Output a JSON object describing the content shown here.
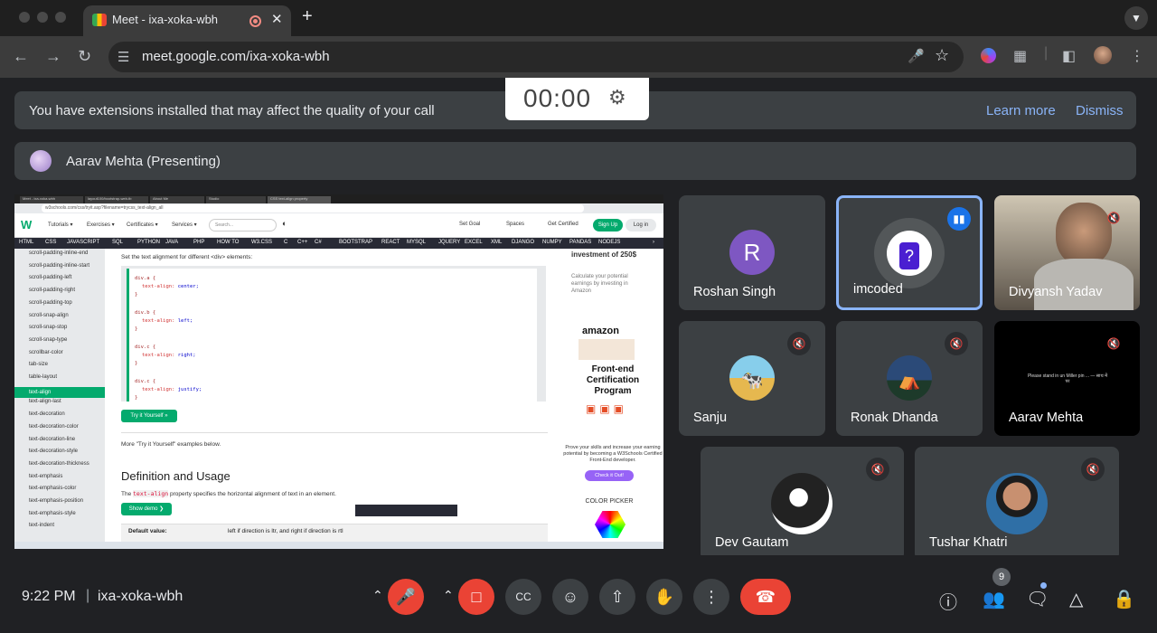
{
  "browser": {
    "tab_title": "Meet - ixa-xoka-wbh",
    "url": "meet.google.com/ixa-xoka-wbh",
    "new_tab": "+",
    "close": "✕"
  },
  "banner": {
    "message": "You have extensions installed that may affect the quality of your call",
    "learn_more": "Learn more",
    "dismiss": "Dismiss"
  },
  "timer": {
    "time": "00:00"
  },
  "presenter": {
    "label": "Aarav Mehta (Presenting)"
  },
  "shared_screen": {
    "mini_tabs": [
      "Meet - ixa-xoka-wbh",
      "layout100/bootstrap-web-tb",
      "About Me",
      "Studio",
      "CSS text-align property"
    ],
    "mini_url": "w3schools.com/css/tryit.asp?filename=trycss_text-align_all",
    "logo": "W",
    "nav": [
      "Tutorials ▾",
      "Exercises ▾",
      "Certificates ▾",
      "Services ▾"
    ],
    "search_placeholder": "Search...",
    "nav_right": [
      "Set Goal",
      "Spaces",
      "Get Certified"
    ],
    "sign_up": "Sign Up",
    "log_in": "Log in",
    "menu": [
      "HTML",
      "CSS",
      "JAVASCRIPT",
      "SQL",
      "PYTHON",
      "JAVA",
      "PHP",
      "HOW TO",
      "W3.CSS",
      "C",
      "C++",
      "C#",
      "BOOTSTRAP",
      "REACT",
      "MYSQL",
      "JQUERY",
      "EXCEL",
      "XML",
      "DJANGO",
      "NUMPY",
      "PANDAS",
      "NODEJS"
    ],
    "sidebar": [
      "scroll-padding-inline-end",
      "scroll-padding-inline-start",
      "scroll-padding-left",
      "scroll-padding-right",
      "scroll-padding-top",
      "scroll-snap-align",
      "scroll-snap-stop",
      "scroll-snap-type",
      "scrollbar-color",
      "tab-size",
      "table-layout",
      "text-align",
      "text-align-last",
      "text-decoration",
      "text-decoration-color",
      "text-decoration-line",
      "text-decoration-style",
      "text-decoration-thickness",
      "text-emphasis",
      "text-emphasis-color",
      "text-emphasis-position",
      "text-emphasis-style",
      "text-indent"
    ],
    "sidebar_active": "text-align",
    "intro": "Set the text alignment for different <div> elements:",
    "code": [
      {
        "sel": "div.a {",
        "prop": "text-align:",
        "val": "center;"
      },
      {
        "sel": "div.b {",
        "prop": "text-align:",
        "val": "left;"
      },
      {
        "sel": "div.c {",
        "prop": "text-align:",
        "val": "right;"
      },
      {
        "sel": "div.c {",
        "prop": "text-align:",
        "val": "justify;"
      }
    ],
    "close_brace": "}",
    "try_btn": "Try it Yourself »",
    "more": "More \"Try it Yourself\" examples below.",
    "def_heading": "Definition and Usage",
    "def_text_pre": "The",
    "def_code": "text-align",
    "def_text_post": "property specifies the horizontal alignment of text in an element.",
    "show_demo": "Show demo ❯",
    "default_label": "Default value:",
    "default_value": "left if direction is ltr, and right if direction is rtl",
    "ad": {
      "heading": "investment of 250$",
      "sub": "Calculate your potential earnings by investing in Amazon",
      "amazon": "amazon",
      "cert_title": "Front-end Certification Program",
      "cert_text": "Prove your skills and increase your earning potential by becoming a W3Schools Certified Front-End developer.",
      "check": "Check it Out!",
      "color_picker": "COLOR PICKER"
    }
  },
  "participants": [
    {
      "name": "Roshan Singh",
      "initial": "R"
    },
    {
      "name": "imcoded"
    },
    {
      "name": "Divyansh Yadav"
    },
    {
      "name": "Sanju"
    },
    {
      "name": "Ronak Dhanda"
    },
    {
      "name": "Aarav Mehta"
    },
    {
      "name": "Dev Gautam"
    },
    {
      "name": "Tushar Khatri"
    }
  ],
  "aarav_screen_text": "Please stand in un Miller pin ... — साथ में पर",
  "bottom": {
    "time": "9:22 PM",
    "divider": "|",
    "meeting_code": "ixa-xoka-wbh",
    "people_count": "9"
  },
  "colors": {
    "accent": "#8ab4f8",
    "end_call": "#ea4335",
    "w3green": "#04aa6d"
  }
}
